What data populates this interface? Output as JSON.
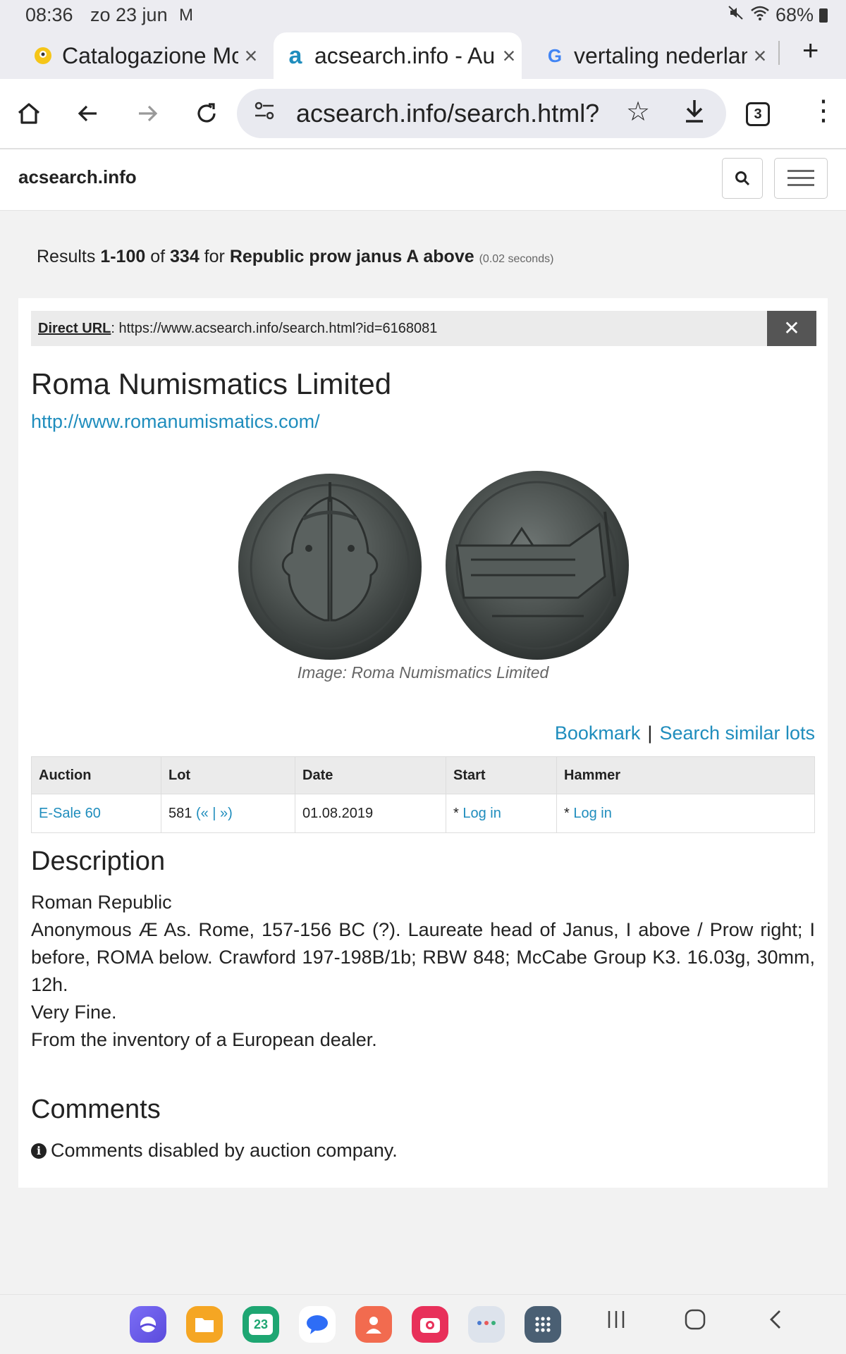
{
  "status": {
    "time": "08:36",
    "date": "zo 23 jun",
    "notification": "M",
    "battery": "68%"
  },
  "tabs": [
    {
      "title": "Catalogazione Mc",
      "favicon": "yellow-face-icon",
      "active": false
    },
    {
      "title": "acsearch.info - Au",
      "favicon": "a",
      "active": true
    },
    {
      "title": "vertaling nederlan",
      "favicon": "G",
      "active": false
    }
  ],
  "toolbar": {
    "url": "acsearch.info/search.html?i",
    "tab_count": "3"
  },
  "site": {
    "brand": "acsearch.info"
  },
  "results": {
    "prefix": "Results ",
    "range": "1-100",
    "of": " of ",
    "total": "334",
    "for": " for ",
    "query": "Republic prow janus A above",
    "time": "(0.02 seconds)"
  },
  "card": {
    "direct_url_label": "Direct URL",
    "direct_url": ": https://www.acsearch.info/search.html?id=6168081",
    "close": "✕",
    "company": "Roma Numismatics Limited",
    "company_url": "http://www.romanumismatics.com/",
    "caption": "Image: Roma Numismatics Limited",
    "bookmark": "Bookmark",
    "separator": "|",
    "similar": "Search similar lots"
  },
  "lot_table": {
    "headers": [
      "Auction",
      "Lot",
      "Date",
      "Start",
      "Hammer"
    ],
    "auction": "E-Sale 60",
    "lot": "581",
    "lot_nav": "(« | »)",
    "date": "01.08.2019",
    "start_prefix": "* ",
    "start": "Log in",
    "hammer_prefix": "* ",
    "hammer": "Log in"
  },
  "description": {
    "heading": "Description",
    "lines": [
      "Roman Republic",
      "Anonymous Æ As. Rome, 157-156 BC (?). Laureate head of Janus, I above / Prow right; I before, ROMA below. Crawford 197-198B/1b; RBW 848; McCabe Group K3. 16.03g, 30mm, 12h.",
      "Very Fine.",
      "From the inventory of a European dealer."
    ]
  },
  "comments": {
    "heading": "Comments",
    "text": "Comments disabled by auction company."
  },
  "dock": {
    "calendar_day": "23"
  }
}
